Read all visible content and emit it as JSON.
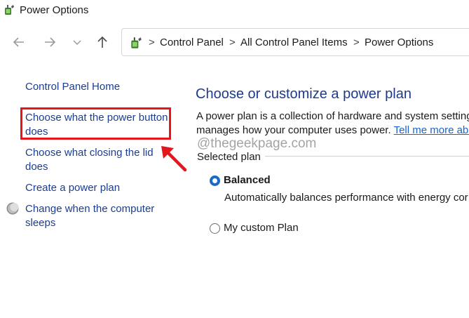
{
  "window": {
    "title": "Power Options",
    "icon": "power-options-icon"
  },
  "nav": {
    "back_icon": "back-arrow-icon",
    "forward_icon": "forward-arrow-icon",
    "recent_icon": "chevron-down-icon",
    "up_icon": "up-arrow-icon"
  },
  "breadcrumb": {
    "items": [
      "Control Panel",
      "All Control Panel Items",
      "Power Options"
    ],
    "separator": ">"
  },
  "sidebar": {
    "home": "Control Panel Home",
    "items": [
      {
        "line1": "Choose what the power button",
        "line2": "does"
      },
      {
        "line1": "Choose what closing the lid",
        "line2": "does"
      },
      {
        "line1": "Create a power plan",
        "line2": ""
      },
      {
        "line1": "Change when the computer",
        "line2": "sleeps"
      }
    ]
  },
  "main": {
    "heading": "Choose or customize a power plan",
    "desc_line1": "A power plan is a collection of hardware and system setting",
    "desc_line2": "manages how your computer uses power.",
    "desc_link": "Tell me more abo",
    "watermark": "@thegeekpage.com",
    "section_label": "Selected plan",
    "plans": [
      {
        "name": "Balanced",
        "selected": true,
        "description": "Automatically balances performance with energy cor"
      },
      {
        "name": "My custom Plan",
        "selected": false,
        "description": ""
      }
    ]
  },
  "colors": {
    "link": "#1b3d8f",
    "heading": "#1e3a8a",
    "accent": "#1b6ac9",
    "annotation": "#e5151c"
  }
}
